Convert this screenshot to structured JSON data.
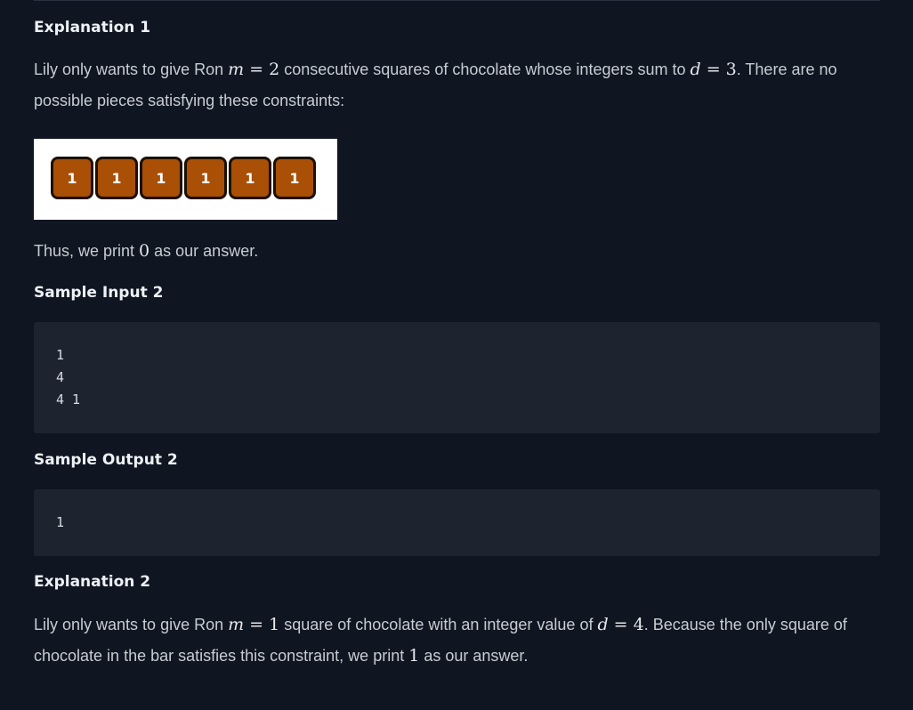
{
  "explanation1": {
    "heading": "Explanation 1",
    "line1": {
      "t1": "Lily only wants to give Ron ",
      "m_var": "m",
      "m_eq": " = 2",
      "t2": " consecutive squares of chocolate whose integers sum to ",
      "d_var": "d",
      "d_eq": " = 3",
      "t3": ". There are no"
    },
    "line2": "possible pieces satisfying these constraints:",
    "squares": [
      "1",
      "1",
      "1",
      "1",
      "1",
      "1"
    ],
    "conclusion": {
      "t1": "Thus, we print ",
      "val": "0",
      "t2": " as our answer."
    }
  },
  "sample_input2": {
    "heading": "Sample Input 2",
    "lines": [
      "1",
      "4",
      "4 1"
    ]
  },
  "sample_output2": {
    "heading": "Sample Output 2",
    "lines": [
      "1"
    ]
  },
  "explanation2": {
    "heading": "Explanation 2",
    "line1": {
      "t1": "Lily only wants to give Ron ",
      "m_var": "m",
      "m_eq": " = 1",
      "t2": " square of chocolate with an integer value of ",
      "d_var": "d",
      "d_eq": " = 4",
      "t3": ". Because the only square of"
    },
    "line2": {
      "t1": "chocolate in the bar satisfies this constraint, we print ",
      "val": "1",
      "t2": " as our answer."
    }
  },
  "colors": {
    "background": "#0f1521",
    "code_bg": "#1e2330",
    "chocolate": "#a94f06",
    "heading": "#eef1f5",
    "text": "#c8ccd3"
  }
}
